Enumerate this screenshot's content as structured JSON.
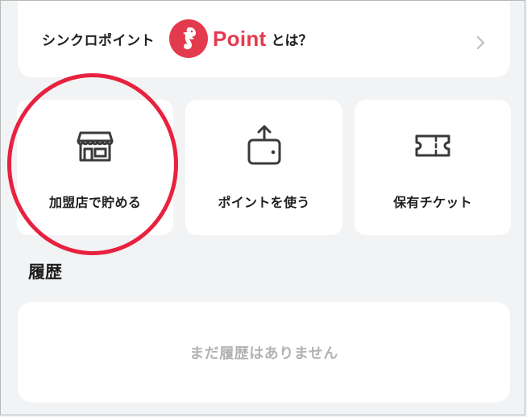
{
  "info": {
    "label": "シンクロポイント",
    "logo_text": "Point",
    "suffix": "とは？"
  },
  "actions": [
    {
      "label": "加盟店で貯める",
      "icon": "storefront-icon"
    },
    {
      "label": "ポイントを使う",
      "icon": "wallet-upload-icon"
    },
    {
      "label": "保有チケット",
      "icon": "ticket-icon"
    }
  ],
  "history": {
    "title": "履歴",
    "empty_message": "まだ履歴はありません"
  },
  "colors": {
    "brand": "#e43a4e",
    "highlight": "#e8213f",
    "background": "#f1f3f4",
    "card": "#ffffff",
    "muted_text": "#b3b3b3"
  }
}
